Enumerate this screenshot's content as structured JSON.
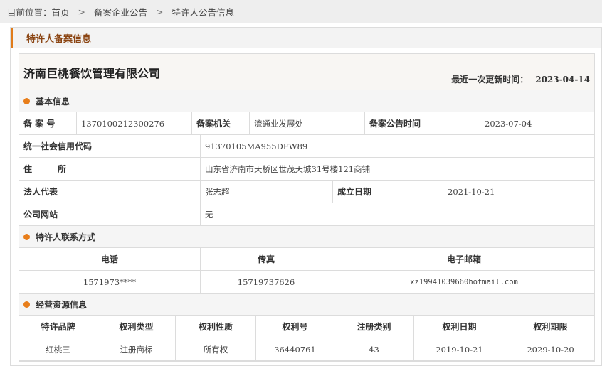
{
  "breadcrumb": {
    "prefix": "目前位置：",
    "items": [
      "首页",
      "备案企业公告",
      "特许人公告信息"
    ],
    "separator": ">"
  },
  "panel": {
    "title": "特许人备案信息"
  },
  "company": {
    "name": "济南巨桃餐饮管理有限公司",
    "update_label": "最近一次更新时间：",
    "update_value": "2023-04-14"
  },
  "basic": {
    "title": "基本信息",
    "record_no_label": "备 案 号",
    "record_no": "1370100212300276",
    "authority_label": "备案机关",
    "authority": "流通业发展处",
    "announce_time_label": "备案公告时间",
    "announce_time": "2023-07-04",
    "credit_code_label": "统一社会信用代码",
    "credit_code": "91370105MA955DFW89",
    "address_label": "住　　　所",
    "address": "山东省济南市天桥区世茂天城31号楼121商铺",
    "legal_rep_label": "法人代表",
    "legal_rep": "张志超",
    "founded_label": "成立日期",
    "founded": "2021-10-21",
    "website_label": "公司网站",
    "website": "无"
  },
  "contact": {
    "title": "特许人联系方式",
    "headers": [
      "电话",
      "传真",
      "电子邮箱"
    ],
    "values": [
      "1571973****",
      "15719737626",
      "xz19941039660hotmail.com"
    ]
  },
  "resources": {
    "title": "经营资源信息",
    "headers": [
      "特许品牌",
      "权利类型",
      "权利性质",
      "权利号",
      "注册类别",
      "权利日期",
      "权利期限"
    ],
    "rows": [
      [
        "红桃三",
        "注册商标",
        "所有权",
        "36440761",
        "43",
        "2019-10-21",
        "2029-10-20"
      ]
    ]
  },
  "colors": {
    "accent": "#e87e1b",
    "panel_title": "#8b4513"
  }
}
